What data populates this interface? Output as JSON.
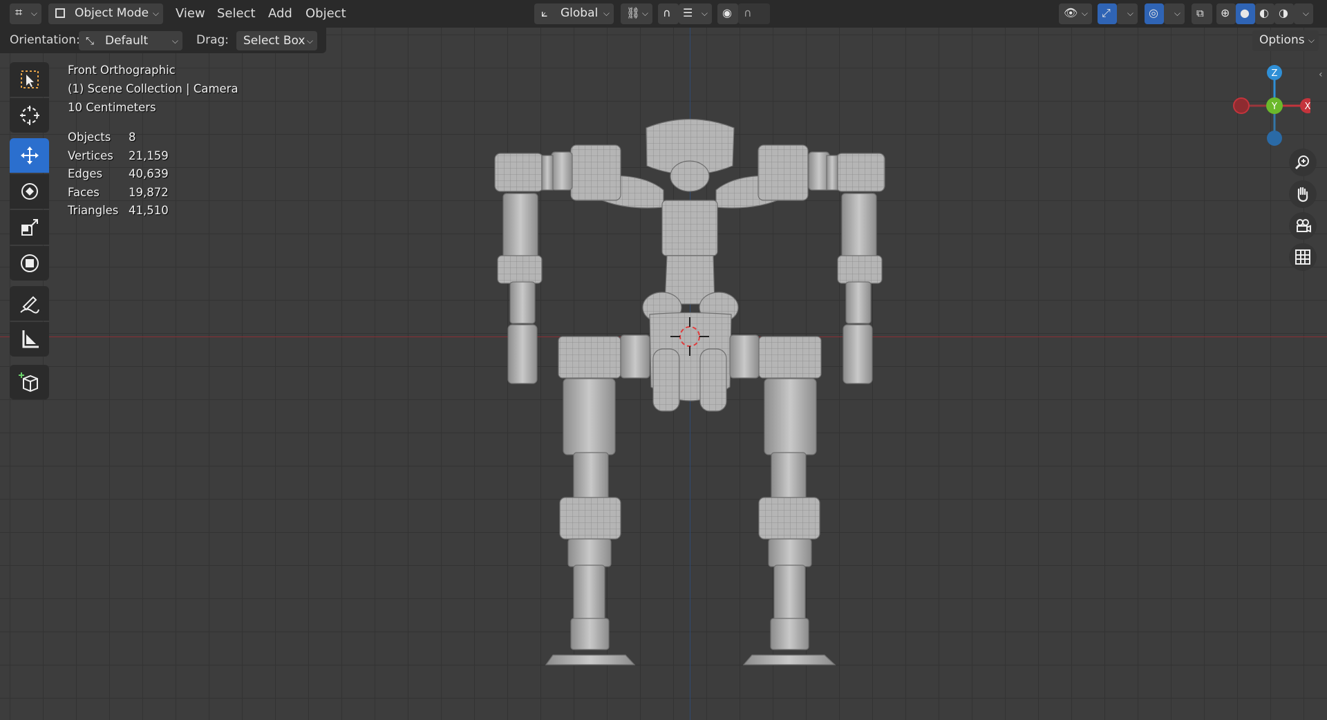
{
  "header": {
    "mode": "Object Mode",
    "menus": [
      "View",
      "Select",
      "Add",
      "Object"
    ],
    "transform_orientation": "Global",
    "options_label": "Options"
  },
  "tool_header": {
    "orientation_label": "Orientation:",
    "orientation_value": "Default",
    "drag_label": "Drag:",
    "drag_value": "Select Box"
  },
  "overlay": {
    "view_name": "Front Orthographic",
    "collection_line": "(1) Scene Collection | Camera",
    "scale": "10 Centimeters",
    "stats": [
      {
        "label": "Objects",
        "value": "8"
      },
      {
        "label": "Vertices",
        "value": "21,159"
      },
      {
        "label": "Edges",
        "value": "40,639"
      },
      {
        "label": "Faces",
        "value": "19,872"
      },
      {
        "label": "Triangles",
        "value": "41,510"
      }
    ]
  },
  "gizmo": {
    "z": "Z",
    "y": "Y",
    "x": "X"
  },
  "toolbar": {
    "tools": [
      "select-box",
      "cursor",
      "move",
      "rotate",
      "scale",
      "transform",
      "annotate",
      "measure",
      "add-cube"
    ],
    "active": "move"
  },
  "colors": {
    "accent": "#2b6fce",
    "x_axis": "#c4343c",
    "y_axis": "#6bb92b",
    "z_axis": "#2f8fd6"
  }
}
